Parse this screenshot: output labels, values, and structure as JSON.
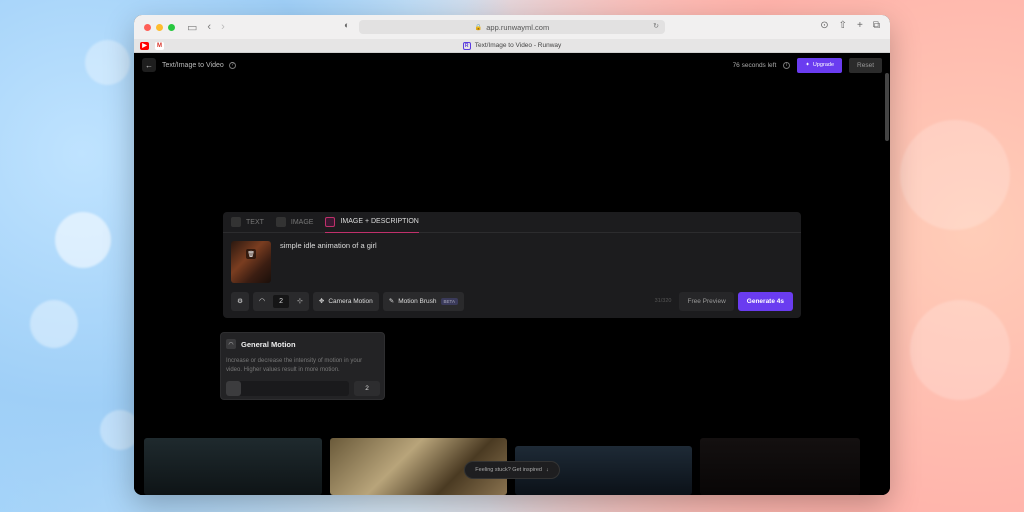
{
  "browser": {
    "url": "app.runwayml.com",
    "tab_title": "Text/Image to Video - Runway",
    "favicons": [
      "youtube-icon",
      "gmail-icon"
    ]
  },
  "header": {
    "title": "Text/Image to Video",
    "time_left": "76 seconds left",
    "upgrade_label": "Upgrade",
    "reset_label": "Reset"
  },
  "tabs": [
    {
      "label": "TEXT",
      "active": false
    },
    {
      "label": "IMAGE",
      "active": false
    },
    {
      "label": "IMAGE + DESCRIPTION",
      "active": true
    }
  ],
  "prompt": {
    "text": "simple idle animation of a girl",
    "char_count": "31/320"
  },
  "controls": {
    "motion_value": "2",
    "camera_motion_label": "Camera Motion",
    "motion_brush_label": "Motion Brush",
    "beta_badge": "BETA",
    "free_preview_label": "Free Preview",
    "generate_label": "Generate 4s"
  },
  "general_motion": {
    "title": "General Motion",
    "description": "Increase or decrease the intensity of motion in your video. Higher values result in more motion.",
    "value": "2",
    "level_fraction": 0.12
  },
  "tip": {
    "label": "Feeling stuck? Get inspired"
  },
  "colors": {
    "accent": "#6a3cf0",
    "active_tab": "#c0306b"
  }
}
